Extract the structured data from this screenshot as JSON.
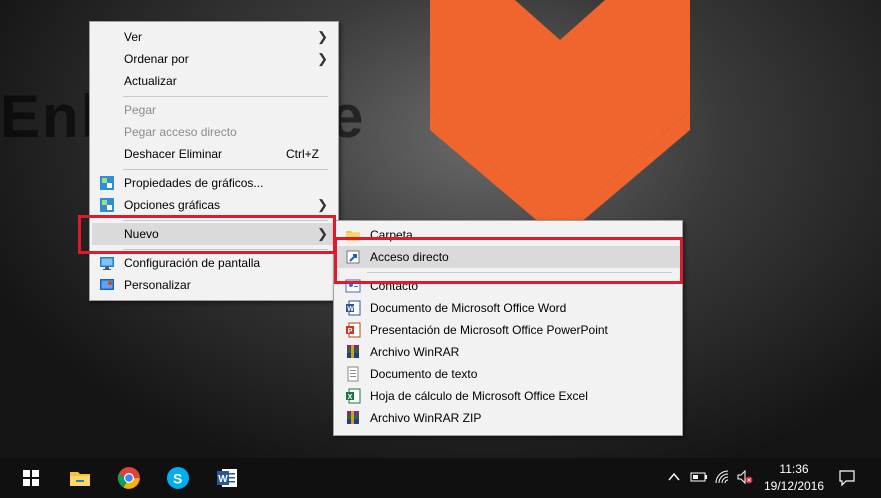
{
  "desktop": {
    "watermark_left": "Enle",
    "watermark_right": "e",
    "brand_color": "#f0642d"
  },
  "context_menu": {
    "items": [
      {
        "label": "Ver",
        "submenu": true
      },
      {
        "label": "Ordenar por",
        "submenu": true
      },
      {
        "label": "Actualizar"
      },
      {
        "label": "Pegar",
        "disabled": true
      },
      {
        "label": "Pegar acceso directo",
        "disabled": true
      },
      {
        "label": "Deshacer Eliminar",
        "shortcut": "Ctrl+Z"
      },
      {
        "label": "Propiedades de gráficos...",
        "icon": "intel-graphics-icon"
      },
      {
        "label": "Opciones gráficas",
        "icon": "intel-graphics-icon",
        "submenu": true
      },
      {
        "label": "Nuevo",
        "submenu": true,
        "highlighted": true
      },
      {
        "label": "Configuración de pantalla",
        "icon": "display-icon"
      },
      {
        "label": "Personalizar",
        "icon": "personalize-icon"
      }
    ]
  },
  "new_submenu": {
    "items": [
      {
        "label": "Carpeta",
        "icon": "folder-icon"
      },
      {
        "label": "Acceso directo",
        "icon": "shortcut-icon",
        "highlighted": true
      },
      {
        "label": "Contacto",
        "icon": "contact-icon"
      },
      {
        "label": "Documento de Microsoft Office Word",
        "icon": "word-doc-icon"
      },
      {
        "label": "Presentación de Microsoft Office PowerPoint",
        "icon": "powerpoint-icon"
      },
      {
        "label": "Archivo WinRAR",
        "icon": "winrar-icon"
      },
      {
        "label": "Documento de texto",
        "icon": "text-doc-icon"
      },
      {
        "label": "Hoja de cálculo de Microsoft Office Excel",
        "icon": "excel-icon"
      },
      {
        "label": "Archivo WinRAR ZIP",
        "icon": "winrar-zip-icon"
      }
    ]
  },
  "taskbar": {
    "apps": [
      "start-icon",
      "file-explorer-icon",
      "chrome-icon",
      "skype-icon",
      "word-icon"
    ],
    "time": "11:36",
    "date": "19/12/2016"
  },
  "highlight_color": "#e0192b"
}
